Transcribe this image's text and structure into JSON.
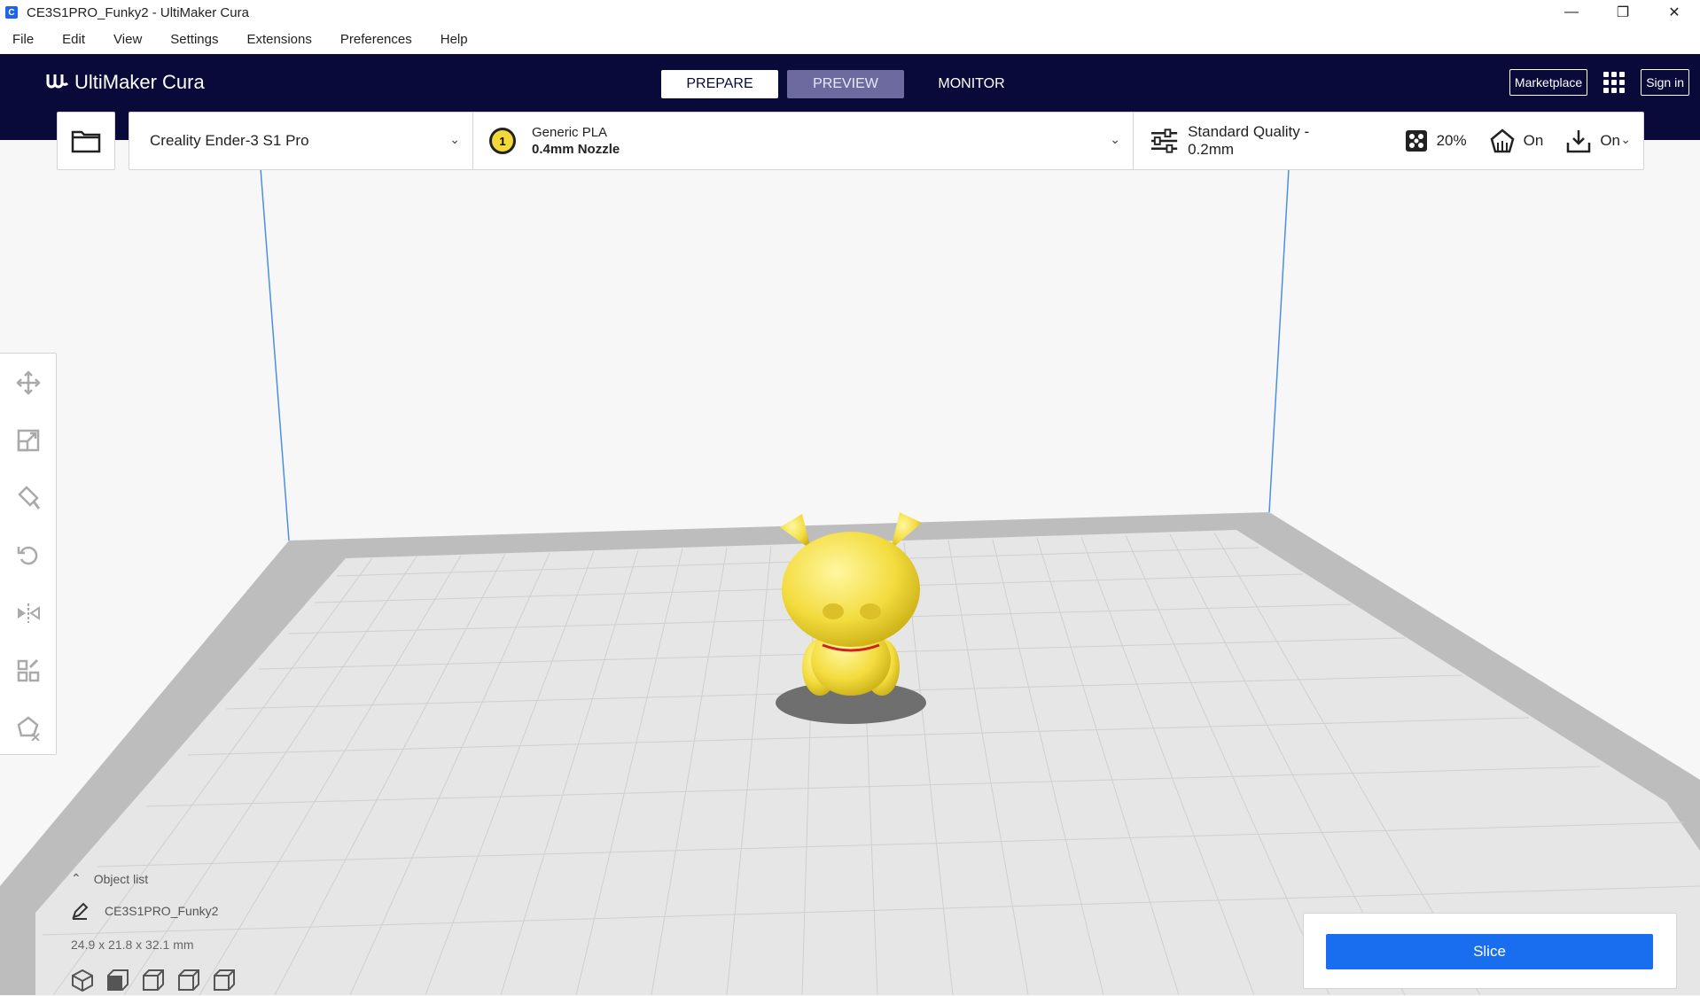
{
  "window": {
    "title": "CE3S1PRO_Funky2 - UltiMaker Cura",
    "app_icon_letter": "C"
  },
  "menu": [
    "File",
    "Edit",
    "View",
    "Settings",
    "Extensions",
    "Preferences",
    "Help"
  ],
  "header": {
    "logo_text": "UltiMaker Cura",
    "tabs": {
      "prepare": "PREPARE",
      "preview": "PREVIEW",
      "monitor": "MONITOR"
    },
    "marketplace_label": "Marketplace",
    "signin_label": "Sign in"
  },
  "printer": {
    "name": "Creality Ender-3 S1 Pro"
  },
  "material": {
    "extruder_number": "1",
    "name": "Generic PLA",
    "nozzle": "0.4mm Nozzle",
    "color": "#f3d83a"
  },
  "print_settings": {
    "profile": "Standard Quality - 0.2mm",
    "infill": "20%",
    "support": "On",
    "adhesion": "On"
  },
  "object_list": {
    "header": "Object list",
    "object_name": "CE3S1PRO_Funky2",
    "dimensions": "24.9 x 21.8 x 32.1 mm"
  },
  "slice": {
    "label": "Slice"
  },
  "colors": {
    "header_bg": "#0a0a3a",
    "accent": "#196ef0",
    "model": "#f5e04a",
    "build_plate": "#e8e8e8"
  }
}
